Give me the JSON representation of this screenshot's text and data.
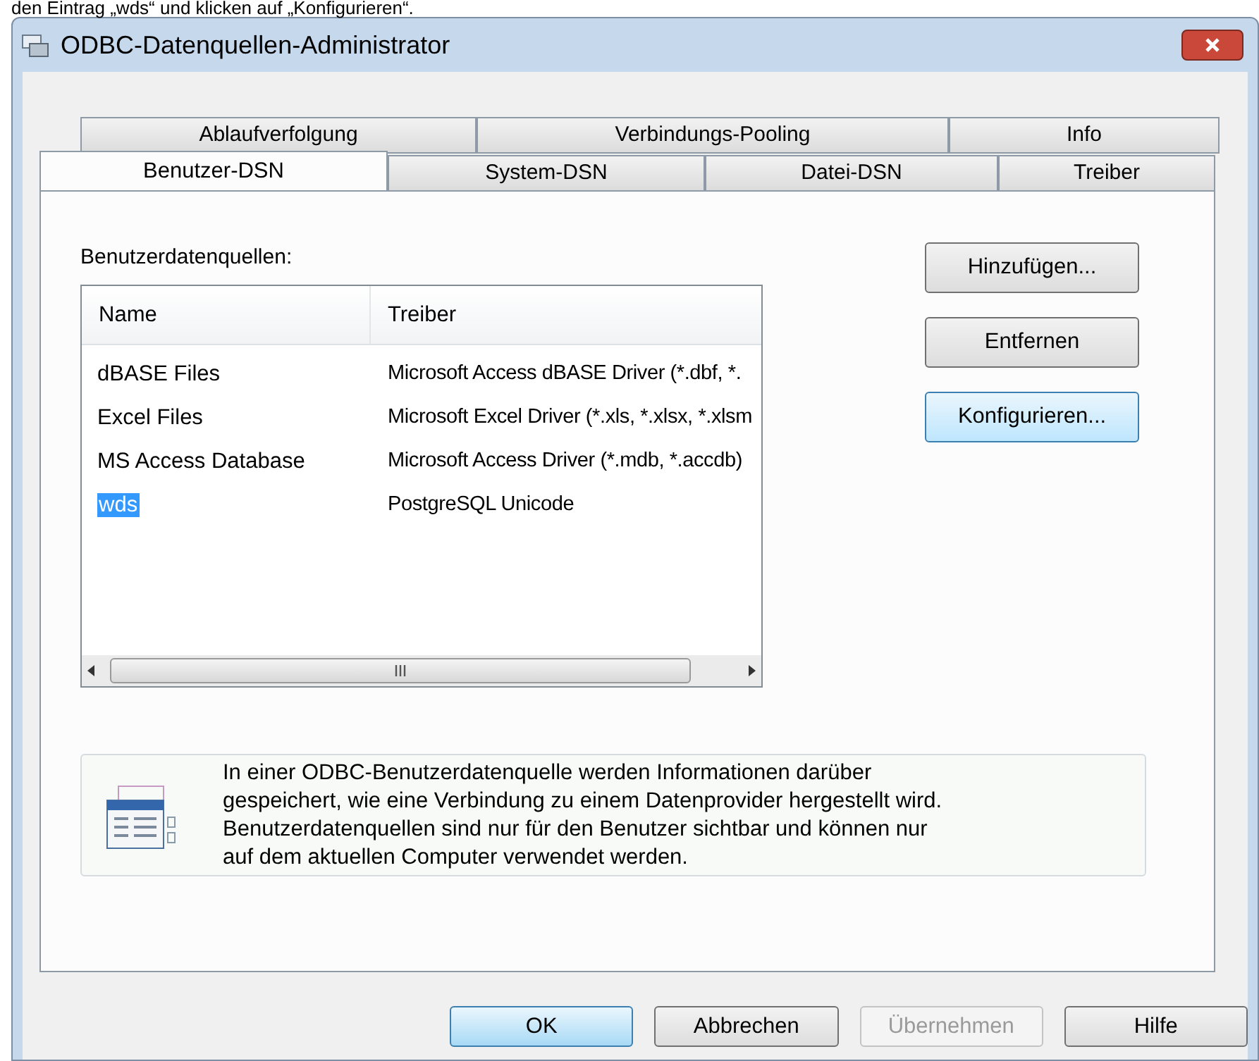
{
  "caption": "den Eintrag „wds“ und klicken auf „Konfigurieren“.",
  "window": {
    "title": "ODBC-Datenquellen-Administrator"
  },
  "tab_rows": [
    [
      {
        "label": "Ablaufverfolgung",
        "selected": false
      },
      {
        "label": "Verbindungs-Pooling",
        "selected": false
      },
      {
        "label": "Info",
        "selected": false
      }
    ],
    [
      {
        "label": "Benutzer-DSN",
        "selected": true
      },
      {
        "label": "System-DSN",
        "selected": false
      },
      {
        "label": "Datei-DSN",
        "selected": false
      },
      {
        "label": "Treiber",
        "selected": false
      }
    ]
  ],
  "list_label": "Benutzerdatenquellen:",
  "table": {
    "columns": [
      "Name",
      "Treiber"
    ],
    "rows": [
      {
        "name": "dBASE Files",
        "driver": "Microsoft Access dBASE Driver (*.dbf, *.",
        "selected": false
      },
      {
        "name": "Excel Files",
        "driver": "Microsoft Excel Driver (*.xls, *.xlsx, *.xlsm",
        "selected": false
      },
      {
        "name": "MS Access Database",
        "driver": "Microsoft Access Driver (*.mdb, *.accdb)",
        "selected": false
      },
      {
        "name": "wds",
        "driver": "PostgreSQL Unicode",
        "selected": true
      }
    ]
  },
  "side_buttons": [
    {
      "label": "Hinzufügen...",
      "focused": false
    },
    {
      "label": "Entfernen",
      "focused": false
    },
    {
      "label": "Konfigurieren...",
      "focused": true
    }
  ],
  "info_lines": [
    "In einer ODBC-Benutzerdatenquelle werden Informationen darüber",
    "gespeichert, wie eine Verbindung zu einem Datenprovider hergestellt wird.",
    "Benutzerdatenquellen sind nur für den Benutzer sichtbar und können nur",
    "auf dem aktuellen Computer verwendet werden."
  ],
  "buttons": [
    {
      "label": "OK",
      "default": true,
      "disabled": false
    },
    {
      "label": "Abbrechen",
      "default": false,
      "disabled": false
    },
    {
      "label": "Übernehmen",
      "default": false,
      "disabled": true
    },
    {
      "label": "Hilfe",
      "default": false,
      "disabled": false
    }
  ]
}
